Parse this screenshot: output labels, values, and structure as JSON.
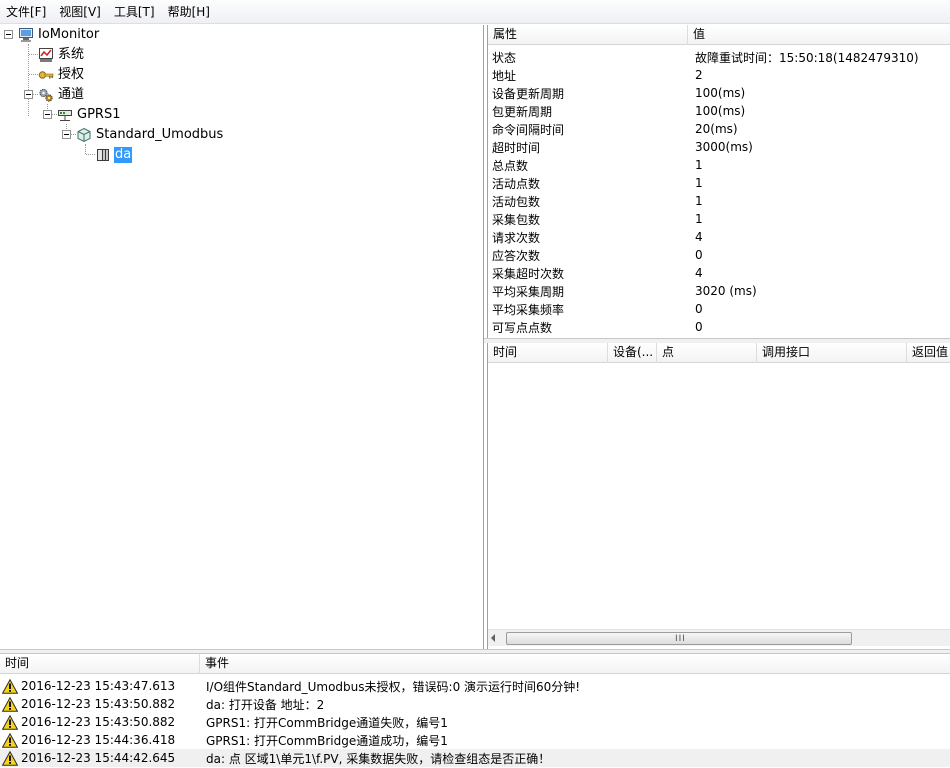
{
  "menu": [
    {
      "id": "file",
      "label": "文件[F]"
    },
    {
      "id": "view",
      "label": "视图[V]"
    },
    {
      "id": "tools",
      "label": "工具[T]"
    },
    {
      "id": "help",
      "label": "帮助[H]"
    }
  ],
  "tree": {
    "root": "IoMonitor",
    "system": "系统",
    "license": "授权",
    "channel": "通道",
    "gprs": "GPRS1",
    "driver": "Standard_Umodbus",
    "device": "da"
  },
  "properties": {
    "columns": [
      "属性",
      "值"
    ],
    "rows": [
      {
        "key": "状态",
        "value": "故障重试时间：15:50:18(1482479310)"
      },
      {
        "key": "地址",
        "value": "2"
      },
      {
        "key": "设备更新周期",
        "value": "100(ms)"
      },
      {
        "key": "包更新周期",
        "value": "100(ms)"
      },
      {
        "key": "命令间隔时间",
        "value": "20(ms)"
      },
      {
        "key": "超时时间",
        "value": "3000(ms)"
      },
      {
        "key": "总点数",
        "value": "1"
      },
      {
        "key": "活动点数",
        "value": "1"
      },
      {
        "key": "活动包数",
        "value": "1"
      },
      {
        "key": "采集包数",
        "value": "1"
      },
      {
        "key": "请求次数",
        "value": "4"
      },
      {
        "key": "应答次数",
        "value": "0"
      },
      {
        "key": "采集超时次数",
        "value": "4"
      },
      {
        "key": "平均采集周期",
        "value": "3020 (ms)"
      },
      {
        "key": "平均采集频率",
        "value": "0"
      },
      {
        "key": "可写点点数",
        "value": "0"
      }
    ]
  },
  "calls": {
    "columns": [
      "时间",
      "设备(...",
      "点",
      "调用接口",
      "返回值"
    ],
    "scroll_grip": "III"
  },
  "events": {
    "columns": [
      "时间",
      "事件"
    ],
    "rows": [
      {
        "time": "2016-12-23 15:43:47.613",
        "event": "I/O组件Standard_Umodbus未授权，错误码:0 演示运行时间60分钟!"
      },
      {
        "time": "2016-12-23 15:43:50.882",
        "event": "da: 打开设备 地址：2"
      },
      {
        "time": "2016-12-23 15:43:50.882",
        "event": "GPRS1: 打开CommBridge通道失败，编号1"
      },
      {
        "time": "2016-12-23 15:44:36.418",
        "event": "GPRS1: 打开CommBridge通道成功，编号1"
      },
      {
        "time": "2016-12-23 15:44:42.645",
        "event": "da: 点 区域1\\单元1\\f.PV, 采集数据失败，请检查组态是否正确！"
      }
    ]
  },
  "colors": {
    "selection": "#3399ff",
    "warning": "#f7d21b"
  }
}
